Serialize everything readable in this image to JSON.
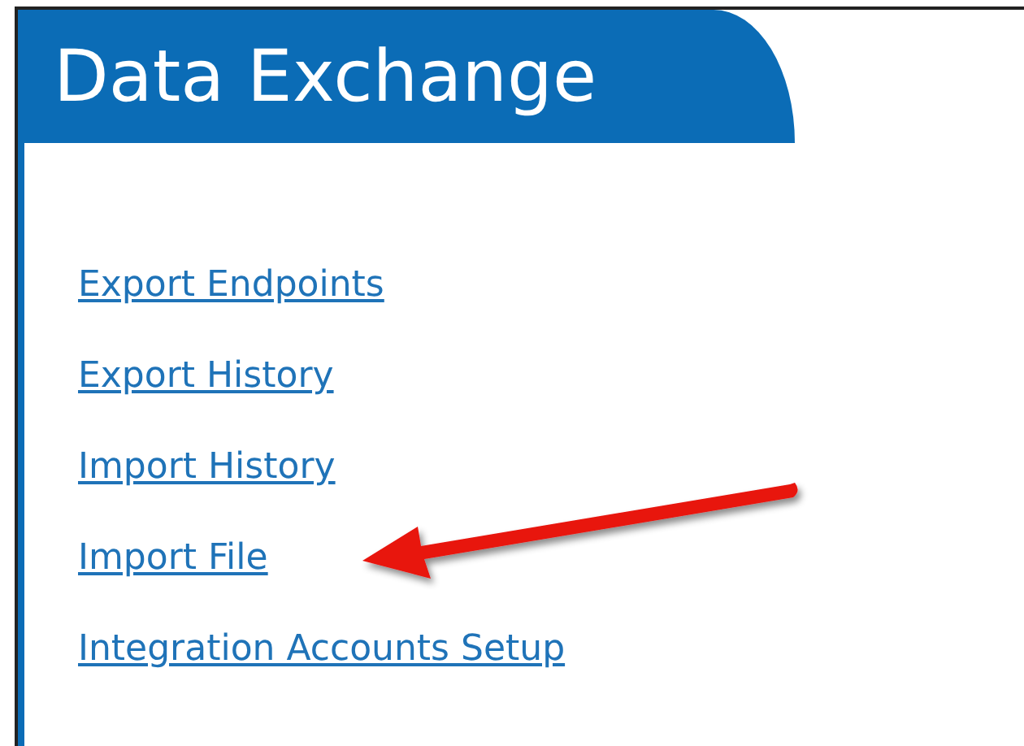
{
  "header": {
    "title": "Data Exchange"
  },
  "links": [
    {
      "label": "Export Endpoints"
    },
    {
      "label": "Export History"
    },
    {
      "label": "Import History"
    },
    {
      "label": "Import File"
    },
    {
      "label": "Integration Accounts Setup"
    }
  ],
  "annotation": {
    "kind": "arrow"
  }
}
